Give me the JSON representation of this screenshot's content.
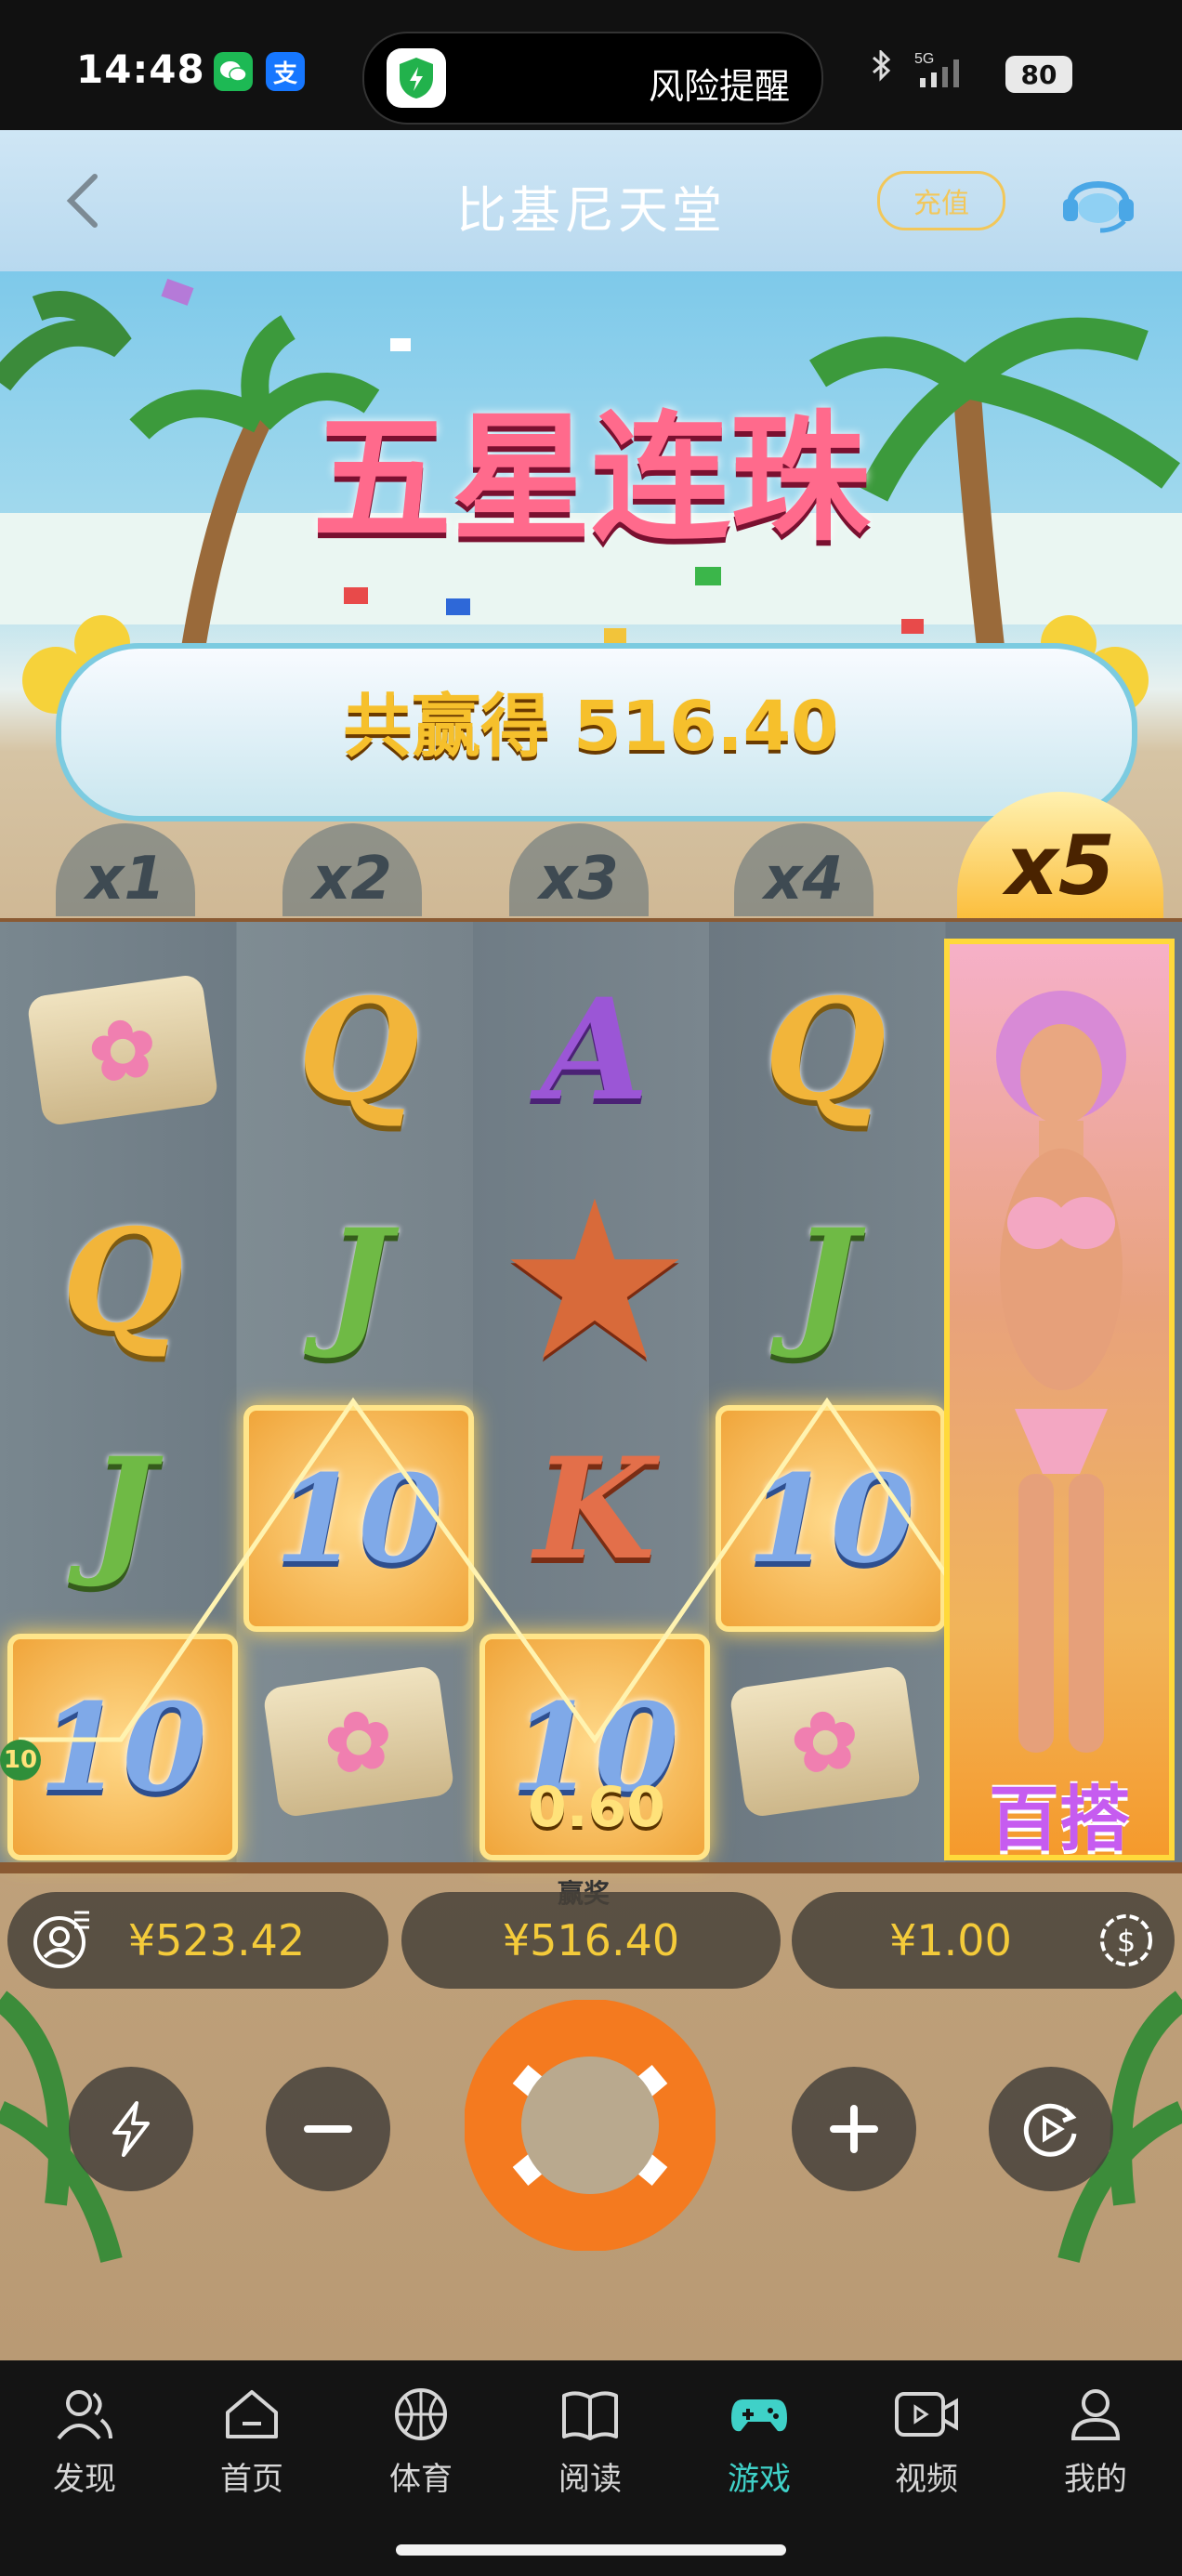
{
  "status_bar": {
    "time": "14:48",
    "app_icons": [
      "wechat-icon",
      "alipay-icon"
    ],
    "alipay_glyph": "支",
    "island_text": "风险提醒",
    "network": "5G",
    "battery": "80"
  },
  "header": {
    "title": "比基尼天堂",
    "recharge_label": "充值"
  },
  "game": {
    "banner_title": "五星连珠",
    "total_win_label": "共赢得 516.40",
    "multipliers": [
      "x1",
      "x2",
      "x3",
      "x4",
      "x5"
    ],
    "active_multiplier": "x5",
    "reels": [
      [
        "towel-flower",
        "Q",
        "J",
        "10"
      ],
      [
        "Q",
        "J",
        "10",
        "towel-flower"
      ],
      [
        "A",
        "starfish",
        "K",
        "10"
      ],
      [
        "Q",
        "J",
        "10",
        "towel-flower"
      ]
    ],
    "wild_label": "百搭",
    "cell_win_value": "0.60",
    "payline_marker": "10",
    "win_caption": "赢奖"
  },
  "controls": {
    "balance": "¥523.42",
    "win": "¥516.40",
    "bet": "¥1.00"
  },
  "nav": {
    "items": [
      {
        "label": "发现",
        "icon": "users-icon"
      },
      {
        "label": "首页",
        "icon": "home-icon"
      },
      {
        "label": "体育",
        "icon": "basketball-icon"
      },
      {
        "label": "阅读",
        "icon": "book-icon"
      },
      {
        "label": "游戏",
        "icon": "gamepad-icon"
      },
      {
        "label": "视频",
        "icon": "video-icon"
      },
      {
        "label": "我的",
        "icon": "profile-icon"
      }
    ],
    "active_index": 4,
    "active_color": "#3fd1c8"
  }
}
